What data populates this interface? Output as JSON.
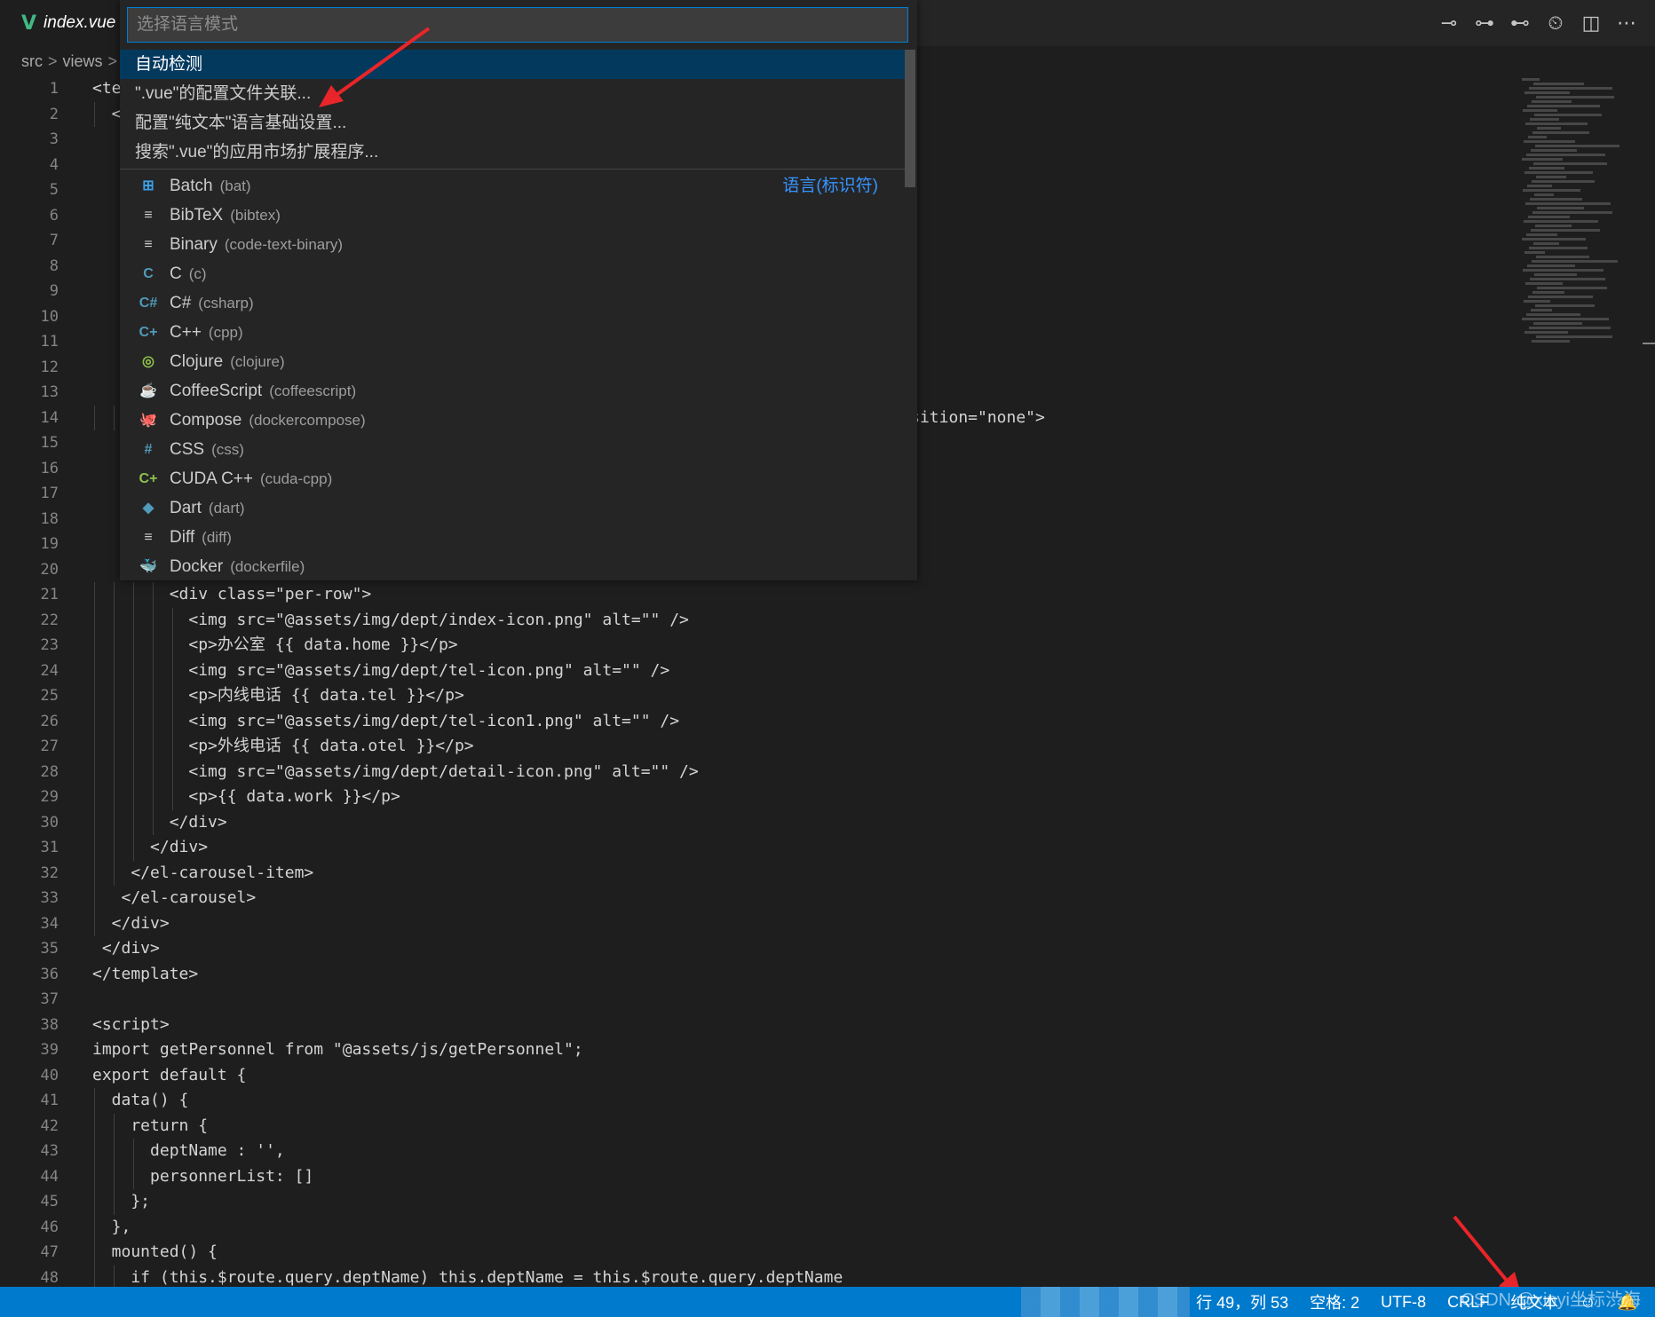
{
  "tab": {
    "title": "index.vue",
    "icon": "vue-file-icon"
  },
  "breadcrumb": {
    "items": [
      "src",
      "views"
    ],
    "separator": ">"
  },
  "actions": [
    {
      "name": "go-back-icon",
      "glyph": "⊸"
    },
    {
      "name": "open-changes-icon",
      "glyph": "⊶"
    },
    {
      "name": "go-forward-icon",
      "glyph": "⊷"
    },
    {
      "name": "timeline-icon",
      "glyph": "⏲"
    },
    {
      "name": "split-editor-icon",
      "glyph": "◫"
    },
    {
      "name": "more-actions-icon",
      "glyph": "⋯"
    }
  ],
  "quickpick": {
    "placeholder": "选择语言模式",
    "items": [
      {
        "label": "自动检测",
        "selected": true
      },
      {
        "label": "\".vue\"的配置文件关联..."
      },
      {
        "label": "配置\"纯文本\"语言基础设置..."
      },
      {
        "label": "搜索\".vue\"的应用市场扩展程序..."
      }
    ],
    "languages": [
      {
        "name": "Batch",
        "id": "(bat)",
        "icon": "windows-icon",
        "glyph": "⊞",
        "color": "#3c9fe6",
        "desc": "语言(标识符)"
      },
      {
        "name": "BibTeX",
        "id": "(bibtex)",
        "icon": "text-file-icon",
        "glyph": "≡",
        "color": "#cccccc"
      },
      {
        "name": "Binary",
        "id": "(code-text-binary)",
        "icon": "text-file-icon",
        "glyph": "≡",
        "color": "#cccccc"
      },
      {
        "name": "C",
        "id": "(c)",
        "icon": "c-icon",
        "glyph": "C",
        "color": "#519aba"
      },
      {
        "name": "C#",
        "id": "(csharp)",
        "icon": "csharp-icon",
        "glyph": "C#",
        "color": "#519aba"
      },
      {
        "name": "C++",
        "id": "(cpp)",
        "icon": "cpp-icon",
        "glyph": "C+",
        "color": "#519aba"
      },
      {
        "name": "Clojure",
        "id": "(clojure)",
        "icon": "clojure-icon",
        "glyph": "◎",
        "color": "#8dc149"
      },
      {
        "name": "CoffeeScript",
        "id": "(coffeescript)",
        "icon": "coffee-icon",
        "glyph": "☕",
        "color": "#cbcb41"
      },
      {
        "name": "Compose",
        "id": "(dockercompose)",
        "icon": "docker-compose-icon",
        "glyph": "🐙",
        "color": "#e64e6e"
      },
      {
        "name": "CSS",
        "id": "(css)",
        "icon": "css-icon",
        "glyph": "#",
        "color": "#519aba"
      },
      {
        "name": "CUDA C++",
        "id": "(cuda-cpp)",
        "icon": "cuda-icon",
        "glyph": "C+",
        "color": "#8dc149"
      },
      {
        "name": "Dart",
        "id": "(dart)",
        "icon": "dart-icon",
        "glyph": "◆",
        "color": "#519aba"
      },
      {
        "name": "Diff",
        "id": "(diff)",
        "icon": "text-file-icon",
        "glyph": "≡",
        "color": "#cccccc"
      },
      {
        "name": "Docker",
        "id": "(dockerfile)",
        "icon": "docker-icon",
        "glyph": "🐳",
        "color": "#519aba"
      }
    ]
  },
  "line_numbers": [
    "1",
    "2",
    "3",
    "4",
    "5",
    "6",
    "7",
    "8",
    "9",
    "10",
    "11",
    "12",
    "13",
    "14",
    "15",
    "16",
    "17",
    "18",
    "19",
    "20",
    "21",
    "22",
    "23",
    "24",
    "25",
    "26",
    "27",
    "28",
    "29",
    "30",
    "31",
    "32",
    "33",
    "34",
    "35",
    "36",
    "37",
    "38",
    "39",
    "40",
    "41",
    "42",
    "43",
    "44",
    "45",
    "46",
    "47",
    "48"
  ],
  "code_lines": [
    "<te",
    "  <",
    "",
    "",
    "",
    "",
    "",
    "",
    "",
    "",
    "",
    "",
    "",
    "                                                                                    osition=\"none\">",
    "",
    "",
    "",
    "",
    "",
    "",
    "        <div class=\"per-row\">",
    "          <img src=\"@assets/img/dept/index-icon.png\" alt=\"\" />",
    "          <p>办公室 {{ data.home }}</p>",
    "          <img src=\"@assets/img/dept/tel-icon.png\" alt=\"\" />",
    "          <p>内线电话 {{ data.tel }}</p>",
    "          <img src=\"@assets/img/dept/tel-icon1.png\" alt=\"\" />",
    "          <p>外线电话 {{ data.otel }}</p>",
    "          <img src=\"@assets/img/dept/detail-icon.png\" alt=\"\" />",
    "          <p>{{ data.work }}</p>",
    "        </div>",
    "      </div>",
    "    </el-carousel-item>",
    "   </el-carousel>",
    "  </div>",
    " </div>",
    "</template>",
    "",
    "<script>",
    "import getPersonnel from \"@assets/js/getPersonnel\";",
    "export default {",
    "  data() {",
    "    return {",
    "      deptName : '',",
    "      personnerList: []",
    "    };",
    "  },",
    "  mounted() {",
    "    if (this.$route.query.deptName) this.deptName = this.$route.query.deptName"
  ],
  "statusbar": {
    "position": "行 49，列 53",
    "spaces": "空格: 2",
    "encoding": "UTF-8",
    "eol": "CRLF",
    "language": "纯文本",
    "color": "#007acc"
  },
  "watermark": "CSDN @xinyi坐标渋海"
}
